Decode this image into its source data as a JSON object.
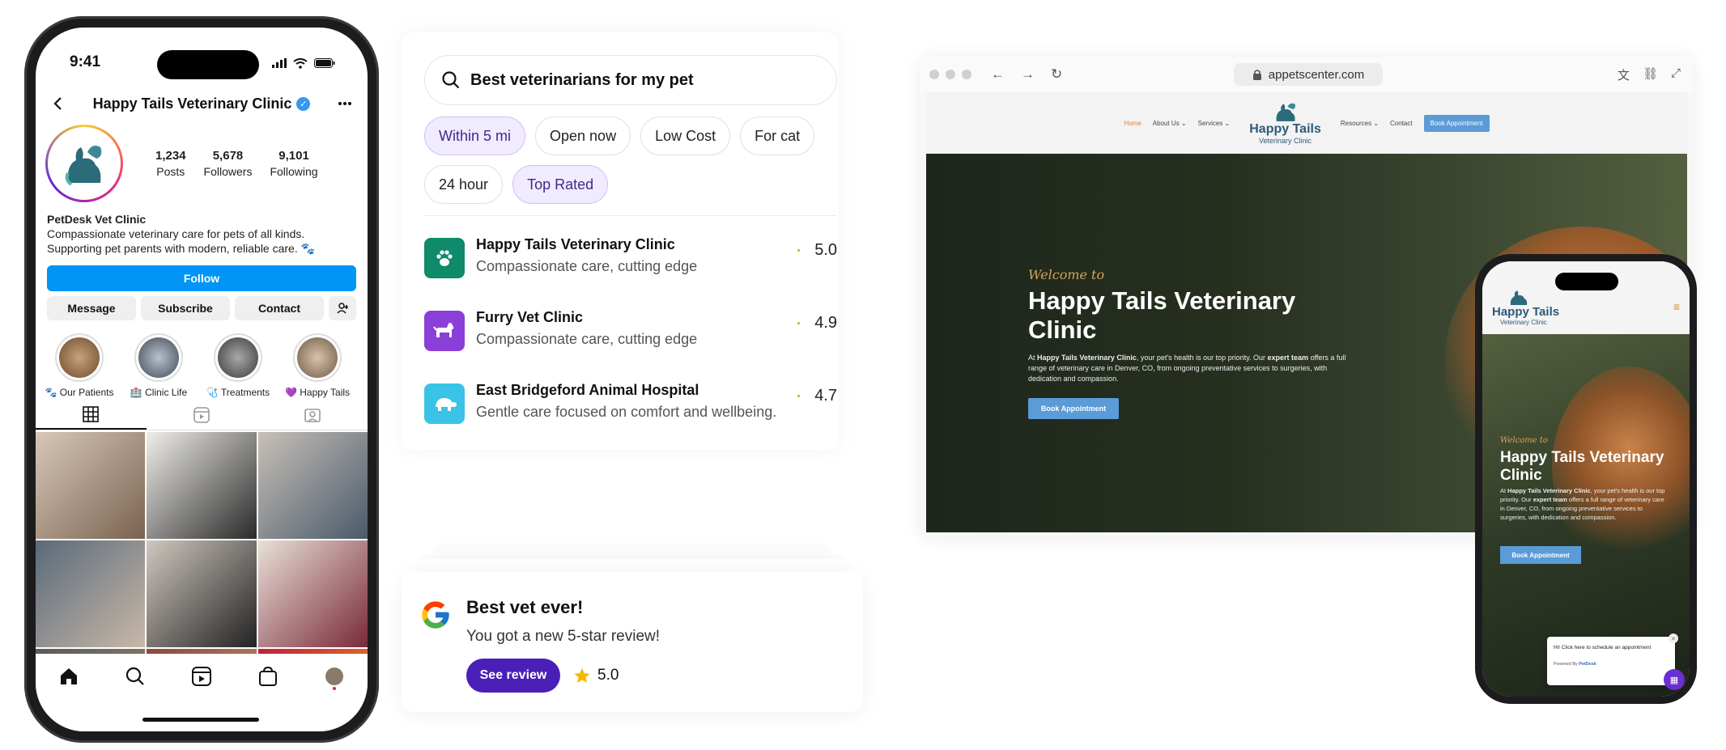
{
  "instagram": {
    "status_time": "9:41",
    "profile_title": "Happy Tails Veterinary Clinic",
    "stats": [
      {
        "value": "1,234",
        "label": "Posts"
      },
      {
        "value": "5,678",
        "label": "Followers"
      },
      {
        "value": "9,101",
        "label": "Following"
      }
    ],
    "bio_name": "PetDesk Vet Clinic",
    "bio_line1": "Compassionate veterinary care for pets of all kinds.",
    "bio_line2": "Supporting pet parents with modern, reliable care. 🐾",
    "follow_label": "Follow",
    "actions": [
      "Message",
      "Subscribe",
      "Contact"
    ],
    "highlights": [
      "🐾 Our Patients",
      "🏥 Clinic Life",
      "🩺 Treatments",
      "💜 Happy Tails"
    ]
  },
  "search": {
    "query": "Best veterinarians for my pet",
    "chips": [
      {
        "label": "Within 5 mi",
        "selected": true
      },
      {
        "label": "Open now",
        "selected": false
      },
      {
        "label": "Low Cost",
        "selected": false
      },
      {
        "label": "For cat",
        "selected": false
      },
      {
        "label": "24 hour",
        "selected": false
      },
      {
        "label": "Top Rated",
        "selected": true
      }
    ],
    "results": [
      {
        "name": "Happy Tails Veterinary Clinic",
        "desc": "Compassionate care, cutting edge",
        "rating": "5.0",
        "color": "#0f8a6a"
      },
      {
        "name": "Furry Vet Clinic",
        "desc": "Compassionate care, cutting edge",
        "rating": "4.9",
        "color": "#8b3fd9"
      },
      {
        "name": "East Bridgeford Animal Hospital",
        "desc": "Gentle care focused on comfort and wellbeing.",
        "rating": "4.7",
        "color": "#39c3e6"
      }
    ]
  },
  "review": {
    "title": "Best vet ever!",
    "subtitle": "You got a new 5-star review!",
    "button": "See review",
    "score": "5.0"
  },
  "browser": {
    "url": "appetscenter.com",
    "nav": {
      "home": "Home",
      "about": "About Us ⌄",
      "services": "Services ⌄",
      "resources": "Resources ⌄",
      "contact": "Contact",
      "book": "Book Appointment"
    },
    "logo_line1": "Happy Tails",
    "logo_line2": "Veterinary Clinic",
    "hero": {
      "welcome": "Welcome to",
      "headline": "Happy Tails Veterinary Clinic",
      "p_intro": "At ",
      "p_bold1": "Happy Tails Veterinary Clinic",
      "p_mid": ", your pet's health is our top priority. Our ",
      "p_bold2": "expert team",
      "p_end": " offers a full range of veterinary care in Denver, CO, from ongoing preventative services to surgeries, with dedication and compassion.",
      "button": "Book Appointment"
    }
  },
  "mobile_site": {
    "logo_line1": "Happy Tails",
    "logo_line2": "Veterinary Clinic",
    "welcome": "Welcome to",
    "headline": "Happy Tails Veterinary Clinic",
    "p_intro": "At ",
    "p_bold1": "Happy Tails Veterinary Clinic",
    "p_mid": ", your pet's health is our top priority. Our ",
    "p_bold2": "expert team",
    "p_end": " offers a full range of veterinary care in Denver, CO, from ongoing preventative services to surgeries, with dedication and compassion.",
    "button": "Book Appointment",
    "chat_text": "Hi! Click here to schedule an appointment",
    "chat_powered": "Powered By",
    "chat_brand": "PetDesk"
  }
}
